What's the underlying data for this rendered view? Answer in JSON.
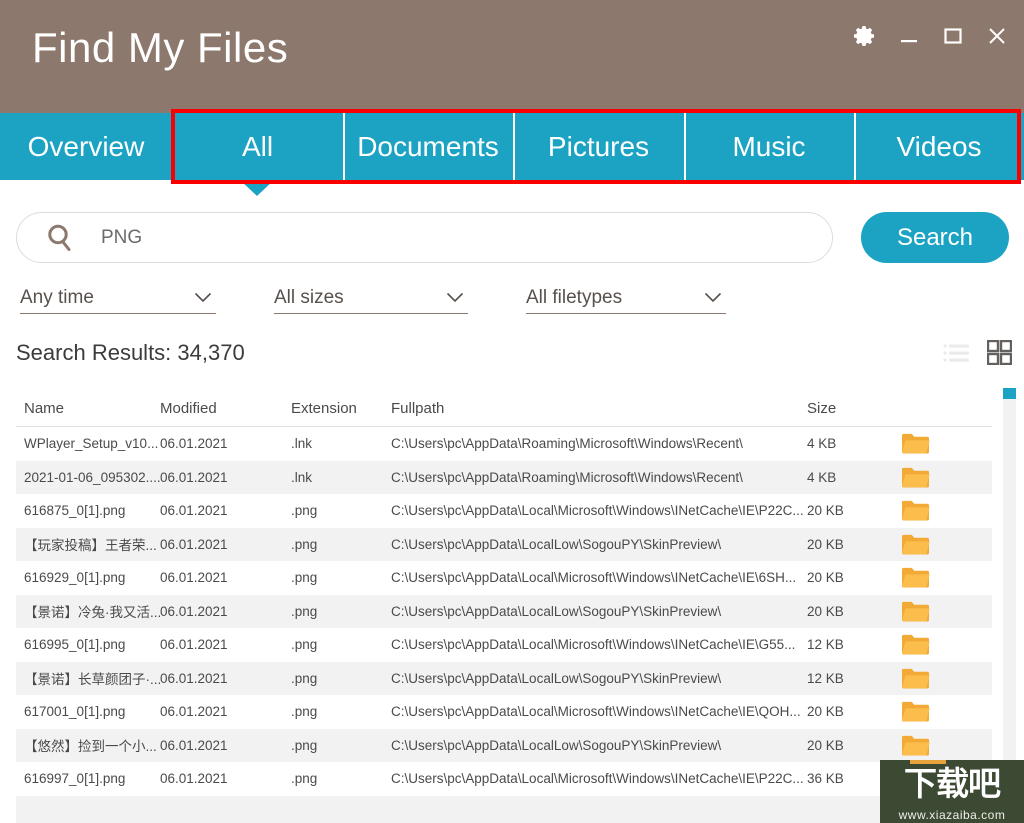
{
  "window": {
    "title": "Find My Files",
    "controls": [
      {
        "name": "settings-icon",
        "label": "Settings"
      },
      {
        "name": "minimize-icon",
        "label": "Minimize"
      },
      {
        "name": "maximize-icon",
        "label": "Maximize"
      },
      {
        "name": "close-icon",
        "label": "Close"
      }
    ],
    "header_color": "#8c786c",
    "accent_color": "#1ca3c4"
  },
  "tabs": [
    {
      "label": "Overview",
      "active": false
    },
    {
      "label": "All",
      "active": true
    },
    {
      "label": "Documents",
      "active": false
    },
    {
      "label": "Pictures",
      "active": false
    },
    {
      "label": "Music",
      "active": false
    },
    {
      "label": "Videos",
      "active": false
    }
  ],
  "annotation": {
    "highlight_color": "#fb0000"
  },
  "search": {
    "value": "PNG",
    "placeholder": "PNG",
    "button_label": "Search",
    "icon": "search-icon"
  },
  "filters": [
    {
      "name": "time-filter",
      "label": "Any time"
    },
    {
      "name": "size-filter",
      "label": "All sizes"
    },
    {
      "name": "filetype-filter",
      "label": "All filetypes"
    }
  ],
  "results": {
    "label": "Search Results:",
    "count": "34,370",
    "text": "Search Results:  34,370",
    "views": [
      {
        "name": "list-view-icon",
        "active": false
      },
      {
        "name": "grid-view-icon",
        "active": true
      }
    ]
  },
  "table": {
    "columns": [
      "Name",
      "Modified",
      "Extension",
      "Fullpath",
      "Size"
    ],
    "rows": [
      {
        "name": "WPlayer_Setup_v10...",
        "modified": "06.01.2021",
        "extension": ".lnk",
        "fullpath": "C:\\Users\\pc\\AppData\\Roaming\\Microsoft\\Windows\\Recent\\",
        "size": "4 KB"
      },
      {
        "name": "2021-01-06_095302....",
        "modified": "06.01.2021",
        "extension": ".lnk",
        "fullpath": "C:\\Users\\pc\\AppData\\Roaming\\Microsoft\\Windows\\Recent\\",
        "size": "4 KB"
      },
      {
        "name": "616875_0[1].png",
        "modified": "06.01.2021",
        "extension": ".png",
        "fullpath": "C:\\Users\\pc\\AppData\\Local\\Microsoft\\Windows\\INetCache\\IE\\P22C...",
        "size": "20 KB"
      },
      {
        "name": "【玩家投稿】王者荣...",
        "modified": "06.01.2021",
        "extension": ".png",
        "fullpath": "C:\\Users\\pc\\AppData\\LocalLow\\SogouPY\\SkinPreview\\",
        "size": "20 KB"
      },
      {
        "name": "616929_0[1].png",
        "modified": "06.01.2021",
        "extension": ".png",
        "fullpath": "C:\\Users\\pc\\AppData\\Local\\Microsoft\\Windows\\INetCache\\IE\\6SH...",
        "size": "20 KB"
      },
      {
        "name": "【景诺】冷兔·我又活...",
        "modified": "06.01.2021",
        "extension": ".png",
        "fullpath": "C:\\Users\\pc\\AppData\\LocalLow\\SogouPY\\SkinPreview\\",
        "size": "20 KB"
      },
      {
        "name": "616995_0[1].png",
        "modified": "06.01.2021",
        "extension": ".png",
        "fullpath": "C:\\Users\\pc\\AppData\\Local\\Microsoft\\Windows\\INetCache\\IE\\G55...",
        "size": "12 KB"
      },
      {
        "name": "【景诺】长草颜团子·...",
        "modified": "06.01.2021",
        "extension": ".png",
        "fullpath": "C:\\Users\\pc\\AppData\\LocalLow\\SogouPY\\SkinPreview\\",
        "size": "12 KB"
      },
      {
        "name": "617001_0[1].png",
        "modified": "06.01.2021",
        "extension": ".png",
        "fullpath": "C:\\Users\\pc\\AppData\\Local\\Microsoft\\Windows\\INetCache\\IE\\QOH...",
        "size": "20 KB"
      },
      {
        "name": "【悠然】捡到一个小...",
        "modified": "06.01.2021",
        "extension": ".png",
        "fullpath": "C:\\Users\\pc\\AppData\\LocalLow\\SogouPY\\SkinPreview\\",
        "size": "20 KB"
      },
      {
        "name": "616997_0[1].png",
        "modified": "06.01.2021",
        "extension": ".png",
        "fullpath": "C:\\Users\\pc\\AppData\\Local\\Microsoft\\Windows\\INetCache\\IE\\P22C...",
        "size": "36 KB"
      }
    ]
  },
  "watermark": {
    "text": "下载吧",
    "url": "www.xiazaiba.com"
  }
}
